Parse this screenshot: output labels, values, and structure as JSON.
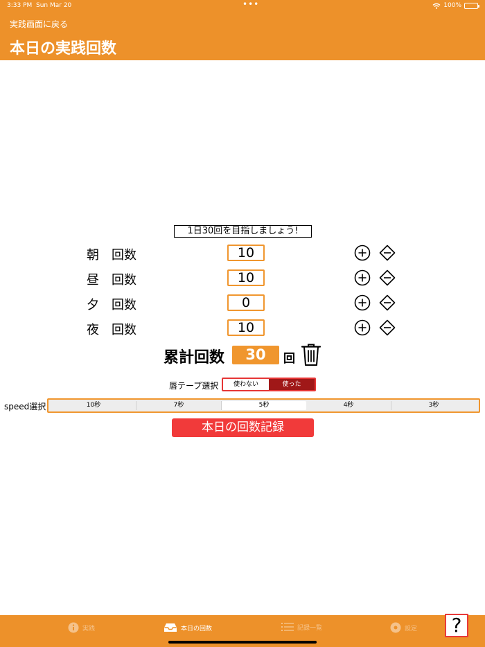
{
  "status_bar": {
    "time": "3:33 PM",
    "date": "Sun Mar 20",
    "dots": "•••",
    "battery": "100%"
  },
  "header": {
    "back_label": "実践画面に戻る",
    "title": "本日の実践回数"
  },
  "goal_text": "1日30回を目指しましょう!",
  "rows": [
    {
      "label": "朝　回数",
      "value": "10"
    },
    {
      "label": "昼　回数",
      "value": "10"
    },
    {
      "label": "夕　回数",
      "value": "0"
    },
    {
      "label": "夜　回数",
      "value": "10"
    }
  ],
  "total": {
    "label": "累計回数",
    "value": "30",
    "unit": "回"
  },
  "tape": {
    "label": "唇テープ選択",
    "options": [
      "使わない",
      "使った"
    ],
    "selected": "使わない"
  },
  "speed": {
    "label": "speed選択",
    "options": [
      "10秒",
      "7秒",
      "5秒",
      "4秒",
      "3秒"
    ],
    "selected": "5秒"
  },
  "record_button": "本日の回数記録",
  "tabs": [
    {
      "label": "実践",
      "icon": "info-circle-icon"
    },
    {
      "label": "本日の回数",
      "icon": "tray-icon"
    },
    {
      "label": "記録一覧",
      "icon": "list-icon"
    },
    {
      "label": "設定",
      "icon": "gear-icon"
    }
  ],
  "help_label": "?",
  "colors": {
    "accent": "#ED912A",
    "value_box": "#F0962E",
    "record": "#F13A3A",
    "dark_red": "#A01818"
  }
}
